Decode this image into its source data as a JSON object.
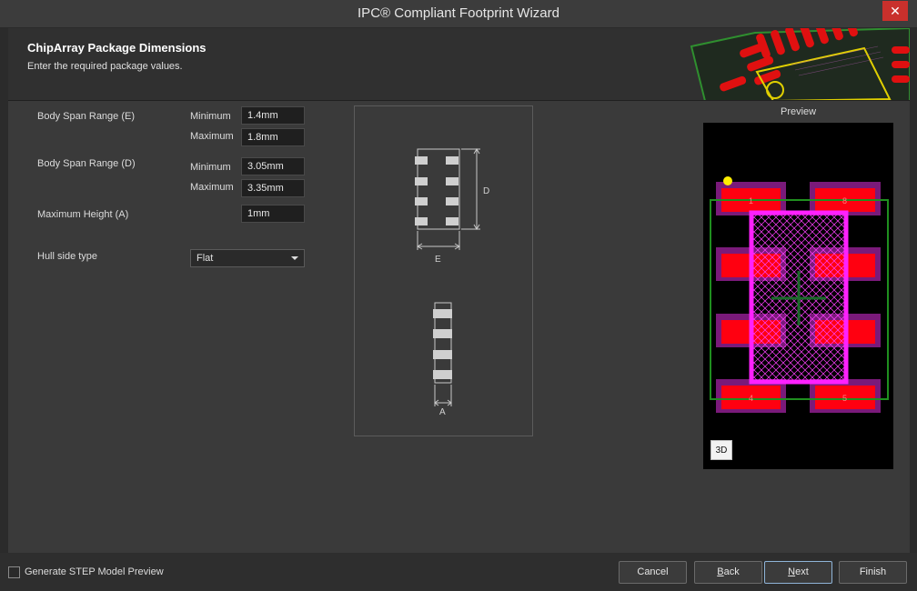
{
  "window": {
    "title": "IPC® Compliant Footprint Wizard",
    "close_glyph": "✕"
  },
  "header": {
    "title": "ChipArray Package Dimensions",
    "subtitle": "Enter the required package values."
  },
  "form": {
    "body_span_e": {
      "label": "Body Span Range (E)",
      "min_label": "Minimum",
      "min_value": "1.4mm",
      "max_label": "Maximum",
      "max_value": "1.8mm"
    },
    "body_span_d": {
      "label": "Body Span Range (D)",
      "min_label": "Minimum",
      "min_value": "3.05mm",
      "max_label": "Maximum",
      "max_value": "3.35mm"
    },
    "max_height": {
      "label": "Maximum Height (A)",
      "value": "1mm"
    },
    "hull_side": {
      "label": "Hull side type",
      "value": "Flat"
    }
  },
  "diagram": {
    "label_d": "D",
    "label_e": "E",
    "label_a": "A"
  },
  "preview": {
    "label": "Preview",
    "pad_labels": [
      "1",
      "8",
      "4",
      "5"
    ],
    "btn_3d": "3D"
  },
  "footer": {
    "checkbox_label": "Generate STEP Model Preview",
    "checkbox_checked": false,
    "cancel": "Cancel",
    "back_b": "B",
    "back_rest": "ack",
    "next_n": "N",
    "next_rest": "ext",
    "finish": "Finish"
  }
}
